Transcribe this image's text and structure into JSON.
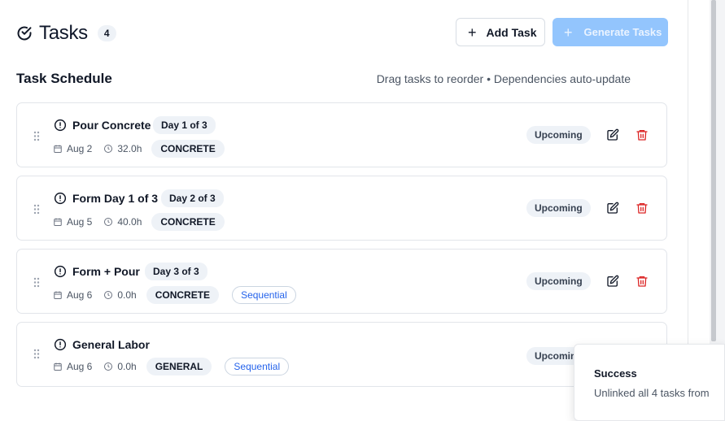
{
  "header": {
    "title": "Tasks",
    "count": "4",
    "add_label": "Add Task",
    "generate_label": "Generate Tasks"
  },
  "schedule": {
    "title": "Task Schedule",
    "hint": "Drag tasks to reorder • Dependencies auto-update"
  },
  "tasks": [
    {
      "name": "Pour Concrete",
      "day": "Day 1 of 3",
      "date": "Aug 2",
      "hours": "32.0h",
      "category": "CONCRETE",
      "sequential": "",
      "status": "Upcoming"
    },
    {
      "name": "Form Day 1 of 3",
      "day": "Day 2 of 3",
      "date": "Aug 5",
      "hours": "40.0h",
      "category": "CONCRETE",
      "sequential": "",
      "status": "Upcoming"
    },
    {
      "name": "Form + Pour",
      "day": "Day 3 of 3",
      "date": "Aug 6",
      "hours": "0.0h",
      "category": "CONCRETE",
      "sequential": "Sequential",
      "status": "Upcoming"
    },
    {
      "name": "General Labor",
      "day": "",
      "date": "Aug 6",
      "hours": "0.0h",
      "category": "GENERAL",
      "sequential": "Sequential",
      "status": "Upcoming"
    }
  ],
  "toast": {
    "title": "Success",
    "message": "Unlinked all 4 tasks from"
  },
  "colors": {
    "primary_disabled": "#93c5fd",
    "danger": "#dc2626",
    "link": "#2563eb"
  },
  "icons": [
    "check-circle-icon",
    "plus-icon",
    "grip-icon",
    "alert-circle-icon",
    "calendar-icon",
    "clock-icon",
    "edit-icon",
    "trash-icon"
  ]
}
